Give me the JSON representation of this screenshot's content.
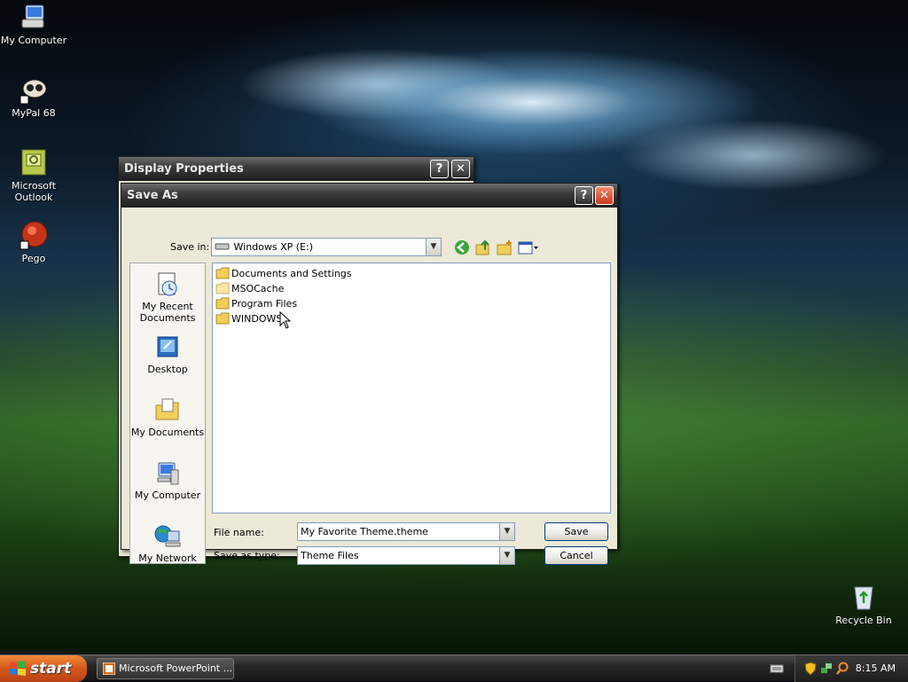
{
  "desktop": {
    "icons": [
      {
        "label": "My Computer",
        "icon": "my-computer-icon"
      },
      {
        "label": "MyPal 68",
        "icon": "mypal-browser-icon"
      },
      {
        "label": "Microsoft Outlook",
        "icon": "outlook-icon"
      },
      {
        "label": "Pego",
        "icon": "pego-icon"
      },
      {
        "label": "Recycle Bin",
        "icon": "recycle-bin-icon"
      }
    ]
  },
  "display_window": {
    "title": "Display Properties",
    "help_glyph": "?",
    "close_glyph": "✕"
  },
  "save_dialog": {
    "title": "Save As",
    "help_glyph": "?",
    "close_glyph": "✕",
    "save_in_label": "Save in:",
    "save_in_value": "Windows XP (E:)",
    "places": [
      "My Recent Documents",
      "Desktop",
      "My Documents",
      "My Computer",
      "My Network"
    ],
    "files": [
      "Documents and Settings",
      "MSOCache",
      "Program Files",
      "WINDOWS"
    ],
    "file_name_label": "File name:",
    "file_name_value": "My Favorite Theme.theme",
    "save_type_label": "Save as type:",
    "save_type_value": "Theme Files",
    "save_button": "Save",
    "cancel_button": "Cancel",
    "toolbar_icons": [
      "back-icon",
      "up-folder-icon",
      "new-folder-icon",
      "views-menu-icon"
    ],
    "colors": {
      "folder": "#f3cf5a",
      "close": "#c63c1e"
    }
  },
  "taskbar": {
    "start_label": "start",
    "task_label": "Microsoft PowerPoint ...",
    "clock": "8:15 AM"
  }
}
